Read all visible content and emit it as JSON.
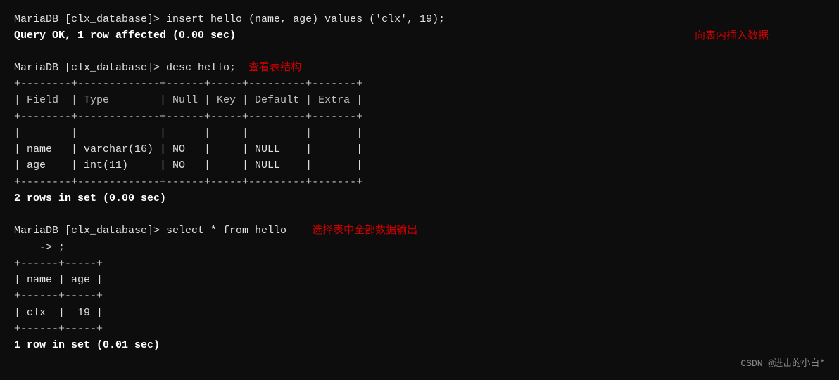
{
  "terminal": {
    "lines": [
      {
        "id": "insert-cmd",
        "text": "MariaDB [clx_database]> insert hello (name, age) values ('clx', 19);",
        "type": "command"
      },
      {
        "id": "query-ok",
        "text": "Query OK, 1 row affected (0.00 sec)",
        "type": "bold"
      },
      {
        "id": "annotation-insert",
        "text": "向表内插入数据",
        "type": "annotation",
        "position": "right"
      },
      {
        "id": "blank1",
        "text": "",
        "type": "blank"
      },
      {
        "id": "desc-cmd",
        "text": "MariaDB [clx_database]> desc hello;",
        "annotation": "查看表结构",
        "type": "command-with-annotation"
      },
      {
        "id": "table-border1",
        "text": "+--------+-------------+------+-----+---------+-------+",
        "type": "table"
      },
      {
        "id": "table-header",
        "text": "| Field  | Type        | Null | Key | Default | Extra |",
        "type": "table"
      },
      {
        "id": "table-border2",
        "text": "+--------+-------------+------+-----+---------+-------+",
        "type": "table"
      },
      {
        "id": "table-blank",
        "text": "|        |             |      |     |         |       |",
        "type": "table-blank"
      },
      {
        "id": "table-row-name",
        "text": "| name   | varchar(16) | NO   |     | NULL    |       |",
        "type": "table"
      },
      {
        "id": "table-row-age",
        "text": "| age    | int(11)     | NO   |     | NULL    |       |",
        "type": "table"
      },
      {
        "id": "table-border3",
        "text": "+--------+-------------+------+-----+---------+-------+",
        "type": "table"
      },
      {
        "id": "rows-result",
        "text": "2 rows in set (0.00 sec)",
        "type": "bold"
      },
      {
        "id": "blank2",
        "text": "",
        "type": "blank"
      },
      {
        "id": "select-cmd",
        "text": "MariaDB [clx_database]> select * from hello",
        "annotation": "选择表中全部数据输出",
        "type": "command-with-annotation"
      },
      {
        "id": "select-cont",
        "text": "    -> ;",
        "type": "command"
      },
      {
        "id": "select-border1",
        "text": "+------+-----+",
        "type": "table"
      },
      {
        "id": "select-header",
        "text": "| name | age |",
        "type": "table"
      },
      {
        "id": "select-border2",
        "text": "+------+-----+",
        "type": "table"
      },
      {
        "id": "select-row",
        "text": "| clx  |  19 |",
        "type": "table"
      },
      {
        "id": "select-border3",
        "text": "+------+-----+",
        "type": "table"
      },
      {
        "id": "row-result",
        "text": "1 row in set (0.01 sec)",
        "type": "bold"
      }
    ],
    "watermark": "CSDN @进击的小白*"
  }
}
